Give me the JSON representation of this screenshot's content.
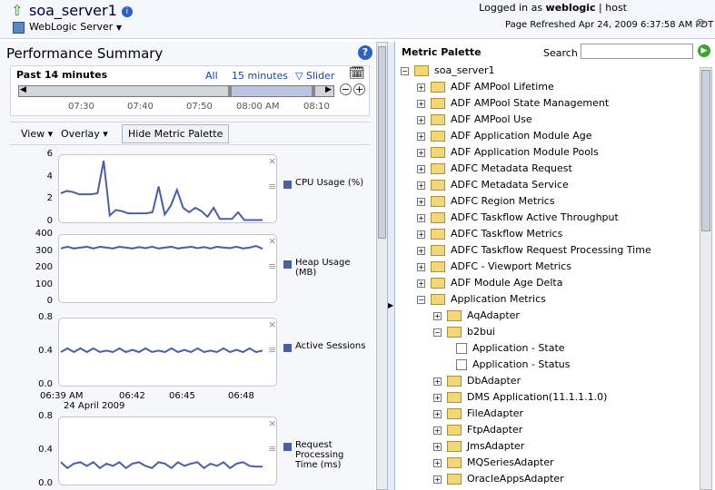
{
  "header": {
    "server": "soa_server1",
    "server_type": "WebLogic Server",
    "logged_prefix": "Logged in as",
    "user": "weblogic",
    "host": "host",
    "refreshed": "Page Refreshed Apr 24, 2009 6:37:58 AM PDT"
  },
  "perf": {
    "title": "Performance Summary",
    "range": "Past 14 minutes",
    "all": "All",
    "min15": "15 minutes",
    "slider": "Slider",
    "timeline": [
      "07:30",
      "07:40",
      "07:50",
      "08:00 AM",
      "08:10"
    ],
    "view": "View",
    "overlay": "Overlay",
    "hide_palette": "Hide Metric Palette"
  },
  "charts": [
    {
      "legend": "CPU Usage (%)",
      "yticks": [
        "6",
        "4",
        "2",
        "0"
      ],
      "ylim": [
        0,
        6
      ],
      "values": [
        2.6,
        2.8,
        2.7,
        2.5,
        2.5,
        2.5,
        2.6,
        5.5,
        0.6,
        1.1,
        1,
        0.8,
        0.8,
        0.8,
        0.8,
        0.9,
        3.2,
        0.7,
        1.5,
        2.9,
        1.3,
        0.9,
        1.3,
        1,
        0.5,
        1.3,
        0.3,
        0.3,
        0.3,
        0.9,
        0.2,
        0.2,
        0.2,
        0.2
      ]
    },
    {
      "legend": "Heap Usage (MB)",
      "yticks": [
        "400",
        "300",
        "200",
        "100",
        "0"
      ],
      "ylim": [
        0,
        400
      ],
      "values": [
        320,
        330,
        320,
        325,
        330,
        320,
        330,
        325,
        320,
        330,
        325,
        320,
        328,
        322,
        330,
        320,
        325,
        330,
        320,
        325,
        330,
        322,
        328,
        320,
        330,
        325,
        322,
        330,
        320,
        325,
        335,
        318
      ]
    },
    {
      "legend": "Active Sessions",
      "yticks": [
        "0.8",
        "0.4",
        "0.0"
      ],
      "ylim": [
        0,
        0.9
      ],
      "values": [
        0.45,
        0.5,
        0.45,
        0.5,
        0.45,
        0.5,
        0.45,
        0.47,
        0.45,
        0.5,
        0.45,
        0.48,
        0.45,
        0.5,
        0.45,
        0.47,
        0.45,
        0.5,
        0.45,
        0.48,
        0.45,
        0.5,
        0.45,
        0.47,
        0.45,
        0.5,
        0.45,
        0.48,
        0.45,
        0.5,
        0.45,
        0.47
      ],
      "xticks": [
        "06:39 AM",
        "06:42",
        "06:45",
        "06:48"
      ],
      "date": "24 April 2009"
    },
    {
      "legend": "Request Processing Time (ms)",
      "yticks": [
        "0.8",
        "0.4",
        "0.0"
      ],
      "ylim": [
        0,
        0.9
      ],
      "values": [
        0.3,
        0.22,
        0.28,
        0.3,
        0.25,
        0.3,
        0.22,
        0.28,
        0.25,
        0.3,
        0.22,
        0.28,
        0.3,
        0.25,
        0.22,
        0.3,
        0.28,
        0.22,
        0.3,
        0.25,
        0.28,
        0.3,
        0.22,
        0.28,
        0.25,
        0.3,
        0.22,
        0.28,
        0.3,
        0.25,
        0.24,
        0.24
      ]
    }
  ],
  "palette": {
    "title": "Metric Palette",
    "search_label": "Search",
    "search_value": "",
    "items": [
      {
        "label": "soa_server1",
        "level": 0,
        "type": "root"
      },
      {
        "label": "ADF AMPool Lifetime",
        "level": 1,
        "type": "folder"
      },
      {
        "label": "ADF AMPool State Management",
        "level": 1,
        "type": "folder"
      },
      {
        "label": "ADF AMPool Use",
        "level": 1,
        "type": "folder"
      },
      {
        "label": "ADF Application Module Age",
        "level": 1,
        "type": "folder"
      },
      {
        "label": "ADF Application Module Pools",
        "level": 1,
        "type": "folder"
      },
      {
        "label": "ADFC Metadata Request",
        "level": 1,
        "type": "folder"
      },
      {
        "label": "ADFC Metadata Service",
        "level": 1,
        "type": "folder"
      },
      {
        "label": "ADFC Region Metrics",
        "level": 1,
        "type": "folder"
      },
      {
        "label": "ADFC Taskflow Active Throughput",
        "level": 1,
        "type": "folder"
      },
      {
        "label": "ADFC Taskflow Metrics",
        "level": 1,
        "type": "folder"
      },
      {
        "label": "ADFC Taskflow Request Processing Time",
        "level": 1,
        "type": "folder"
      },
      {
        "label": "ADFC - Viewport Metrics",
        "level": 1,
        "type": "folder"
      },
      {
        "label": "ADF Module Age Delta",
        "level": 1,
        "type": "folder"
      },
      {
        "label": "Application Metrics",
        "level": 1,
        "type": "open"
      },
      {
        "label": "AqAdapter",
        "level": 2,
        "type": "folder"
      },
      {
        "label": "b2bui",
        "level": 2,
        "type": "open"
      },
      {
        "label": "Application - State",
        "level": 3,
        "type": "check"
      },
      {
        "label": "Application - Status",
        "level": 3,
        "type": "check"
      },
      {
        "label": "DbAdapter",
        "level": 2,
        "type": "folder"
      },
      {
        "label": "DMS Application(11.1.1.1.0)",
        "level": 2,
        "type": "folder"
      },
      {
        "label": "FileAdapter",
        "level": 2,
        "type": "folder"
      },
      {
        "label": "FtpAdapter",
        "level": 2,
        "type": "folder"
      },
      {
        "label": "JmsAdapter",
        "level": 2,
        "type": "folder"
      },
      {
        "label": "MQSeriesAdapter",
        "level": 2,
        "type": "folder"
      },
      {
        "label": "OracleAppsAdapter",
        "level": 2,
        "type": "folder"
      }
    ]
  }
}
